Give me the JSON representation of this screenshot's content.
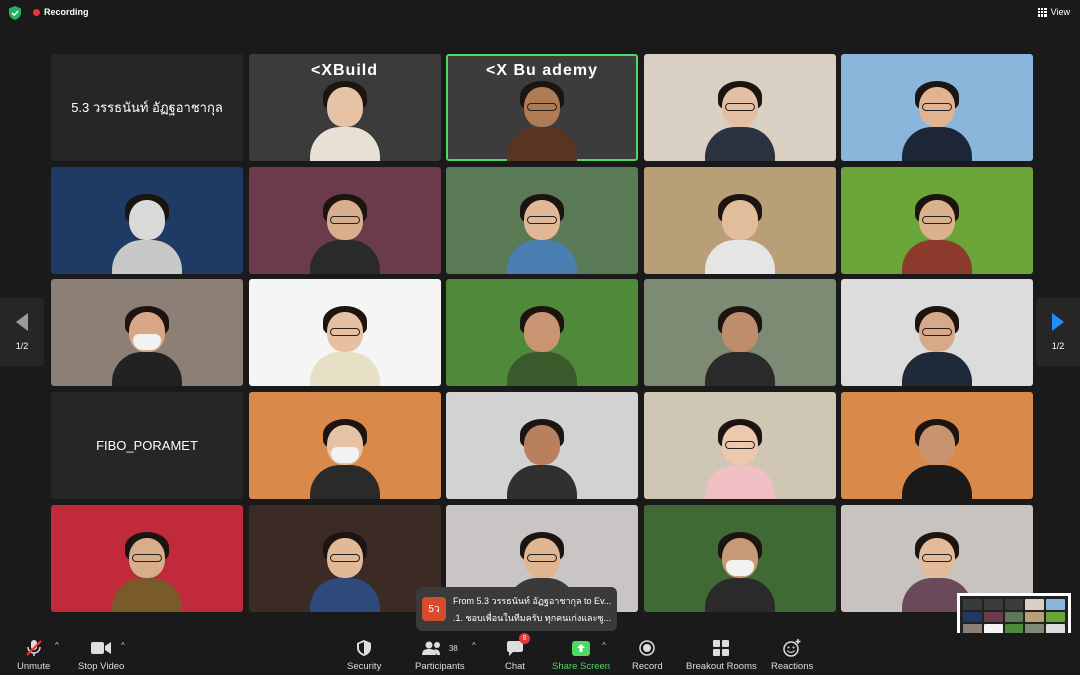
{
  "topbar": {
    "recording": "Recording",
    "view": "View"
  },
  "tiles": [
    {
      "name": "5.3 วรรธนันท์ อัฏฐอาชากุล",
      "kind": "name"
    },
    {
      "kind": "video",
      "logo": "<XBuild",
      "bg": "#3b3b3b",
      "body": "#e9e0d5",
      "skin": "#e7c3a6"
    },
    {
      "kind": "video",
      "logo": "<X Bu   ademy",
      "bg": "#3c3c3c",
      "body": "#5a3422",
      "skin": "#b07a55",
      "active": true,
      "glasses": true
    },
    {
      "kind": "video",
      "bg": "#d9cfc2",
      "body": "#2c3340",
      "skin": "#e3bfa3",
      "glasses": true
    },
    {
      "kind": "video",
      "bg": "#8ab6dc",
      "body": "#1d2637",
      "skin": "#e0b493",
      "glasses": true
    },
    {
      "kind": "video",
      "bg": "#1f3a64",
      "body": "#c8c8c8",
      "skin": "#d9d9d9"
    },
    {
      "kind": "video",
      "bg": "#6b3a4b",
      "body": "#2a2a2a",
      "skin": "#d8ae8c",
      "glasses": true
    },
    {
      "kind": "video",
      "bg": "#5a7a55",
      "body": "#4a7eb0",
      "skin": "#e0b896",
      "glasses": true
    },
    {
      "kind": "video",
      "bg": "#b99f77",
      "body": "#e5e5e5",
      "skin": "#e2bd9b"
    },
    {
      "kind": "video",
      "bg": "#6aa53a",
      "body": "#8c3a2c",
      "skin": "#dcb28e",
      "glasses": true
    },
    {
      "kind": "video",
      "bg": "#8b7f76",
      "body": "#222",
      "skin": "#d8a886",
      "mask": true
    },
    {
      "kind": "video",
      "bg": "#f5f5f5",
      "body": "#e7e0c6",
      "skin": "#e6c0a0",
      "glasses": true
    },
    {
      "kind": "video",
      "bg": "#4e8a3a",
      "body": "#3a5a2c",
      "skin": "#c99472"
    },
    {
      "kind": "video",
      "bg": "#7d8a74",
      "body": "#2a2a2a",
      "skin": "#c08d6c"
    },
    {
      "kind": "video",
      "bg": "#dcdcdc",
      "body": "#1e2a3a",
      "skin": "#d7a988",
      "glasses": true
    },
    {
      "name": "FIBO_PORAMET",
      "kind": "name"
    },
    {
      "kind": "video",
      "bg": "#d98a4a",
      "body": "#2a2a2a",
      "skin": "#e5c2a3",
      "mask": true
    },
    {
      "kind": "video",
      "bg": "#d2d2d2",
      "body": "#303030",
      "skin": "#b8805c"
    },
    {
      "kind": "video",
      "bg": "#cfc6b4",
      "body": "#f0bfc4",
      "skin": "#ecc9ad",
      "glasses": true
    },
    {
      "kind": "video",
      "bg": "#d98a4a",
      "body": "#1a1a1a",
      "skin": "#c89470"
    },
    {
      "kind": "video",
      "bg": "#c02a3a",
      "body": "#7a5a2a",
      "skin": "#d8ad8a",
      "glasses": true
    },
    {
      "kind": "video",
      "bg": "#3b2b24",
      "body": "#2d4a7a",
      "skin": "#e1b997",
      "glasses": true
    },
    {
      "kind": "video",
      "bg": "#c8c5c4",
      "body": "#3a3a3a",
      "skin": "#dfb592",
      "glasses": true
    },
    {
      "kind": "video",
      "bg": "#3f6a34",
      "body": "#2a2a2a",
      "skin": "#c99a76",
      "mask": true
    },
    {
      "kind": "video",
      "bg": "#c9c3bf",
      "body": "#6a4a5a",
      "skin": "#e2bc9a",
      "glasses": true
    }
  ],
  "pager": {
    "left": "1/2",
    "right": "1/2"
  },
  "chat_popup": {
    "avatar": "5ว",
    "line1": "From 5.3 วรรธนันท์ อัฏฐอาชากุล to Ev...",
    "line2": ".1. ชอบเพื่อนในทีมครับ ทุกคนเก่งและซู..."
  },
  "toolbar": {
    "unmute": "Unmute",
    "stop_video": "Stop Video",
    "security": "Security",
    "participants": "Participants",
    "participants_count": "38",
    "chat": "Chat",
    "chat_badge": "8",
    "share_screen": "Share Screen",
    "record": "Record",
    "breakout": "Breakout Rooms",
    "reactions": "Reactions"
  },
  "colors": {
    "accent_green": "#4cd964",
    "record_red": "#e8343a",
    "pager_blue": "#1f8fff"
  }
}
